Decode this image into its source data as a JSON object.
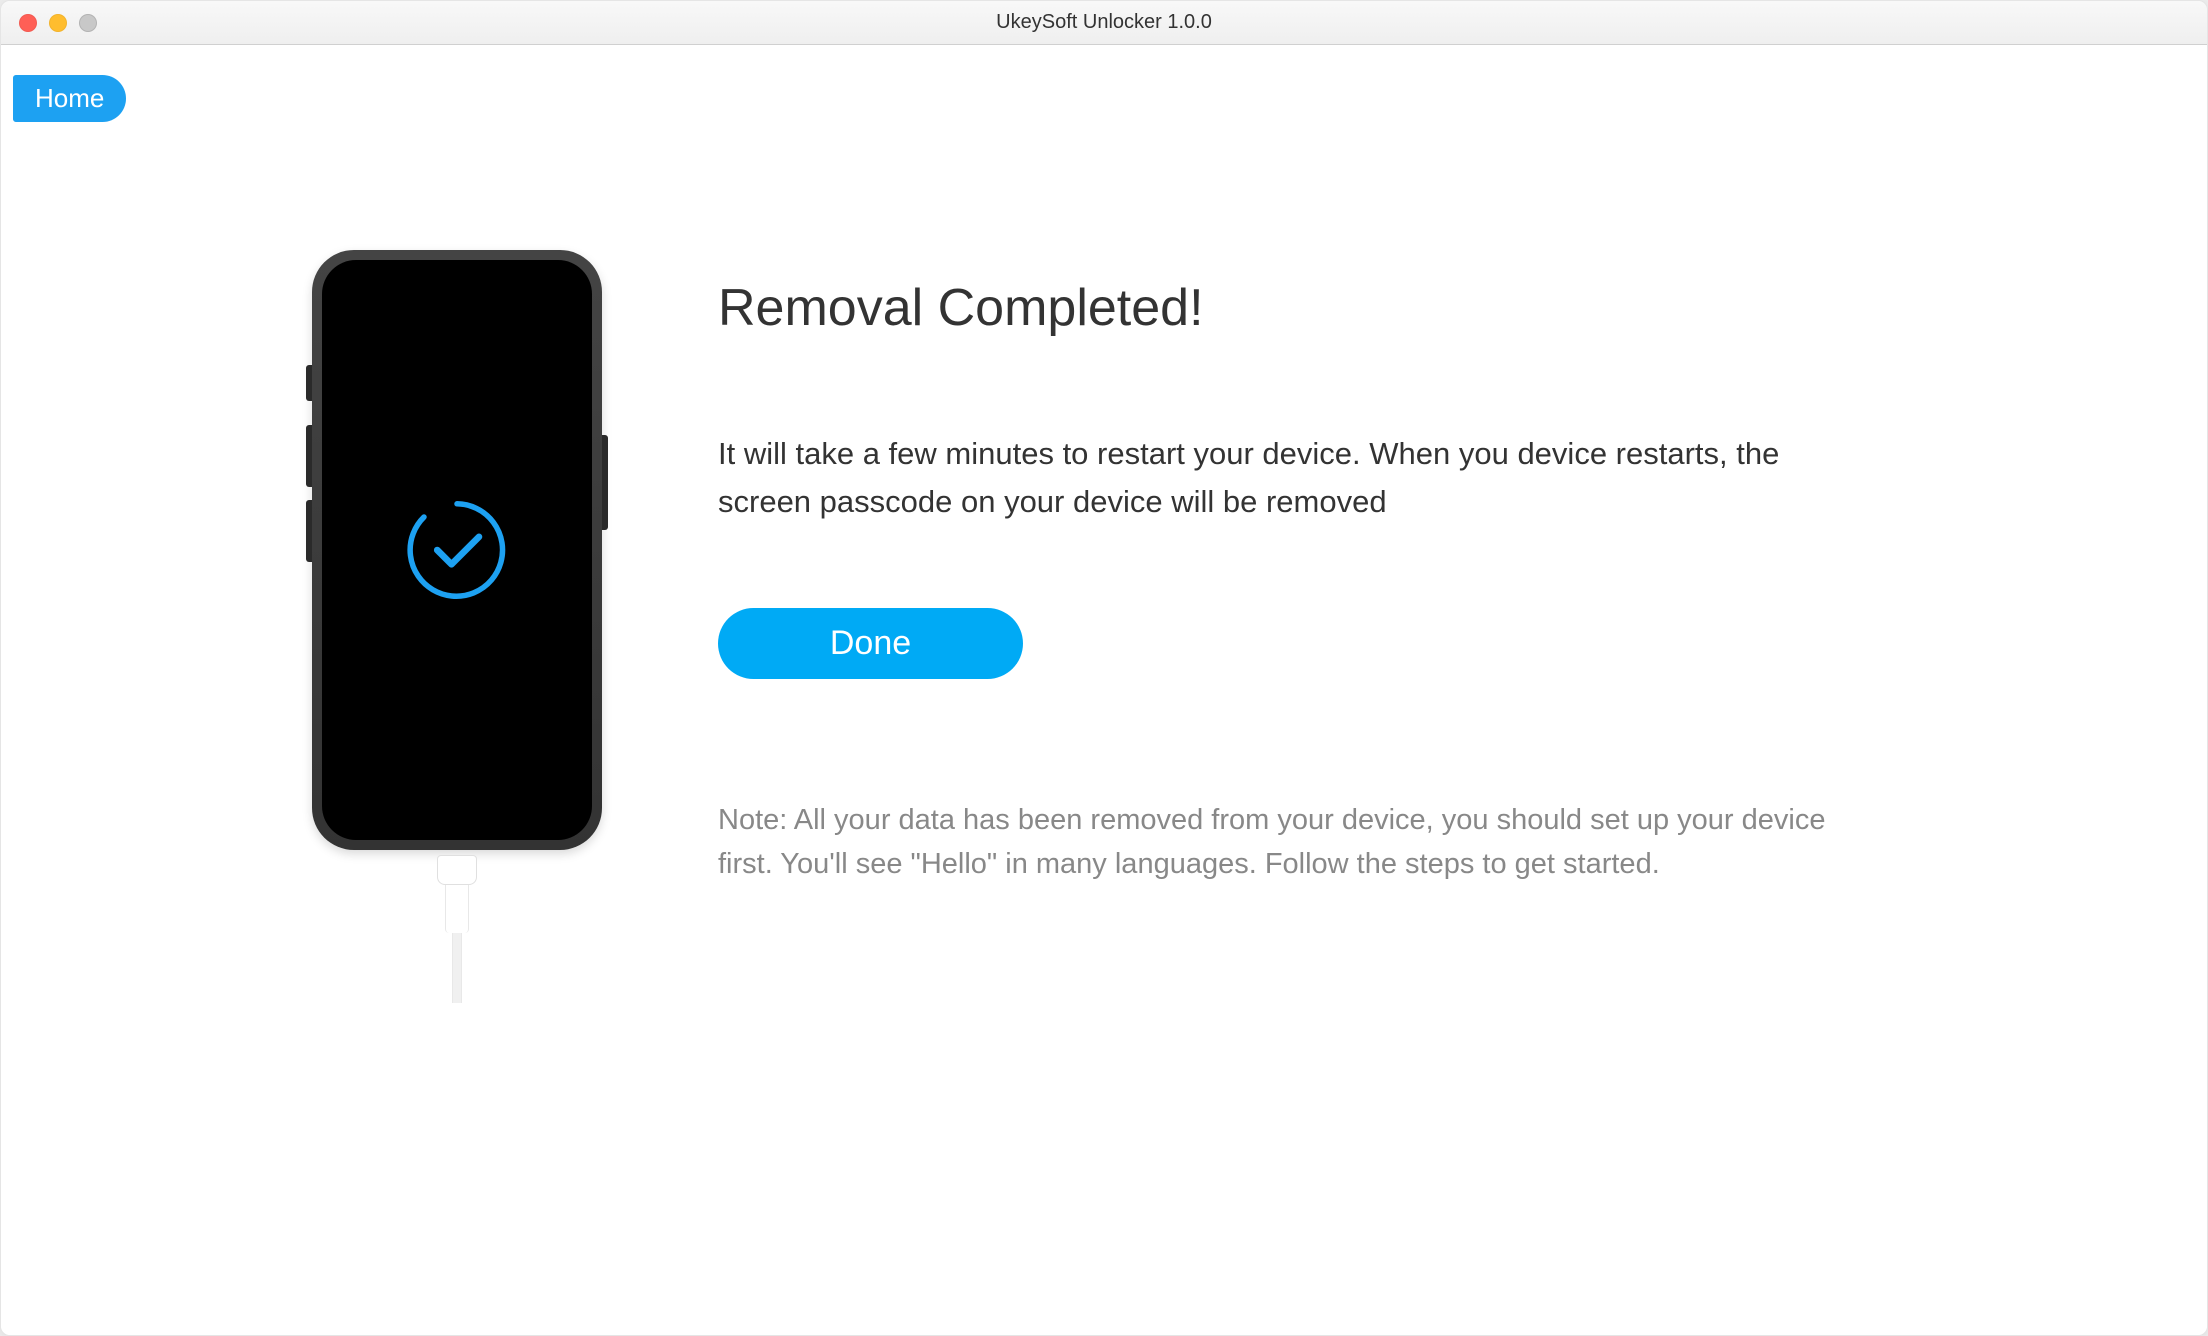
{
  "window": {
    "title": "UkeySoft Unlocker 1.0.0"
  },
  "nav": {
    "home_label": "Home"
  },
  "main": {
    "heading": "Removal Completed!",
    "description": "It will take a few minutes to restart your device. When you device restarts, the screen passcode on your device will be removed",
    "done_label": "Done",
    "note": "Note: All your data has been removed from your device, you should set up your device first. You'll see \"Hello\" in many languages. Follow the steps to get started."
  },
  "colors": {
    "accent": "#1da1f2",
    "button": "#00aaf5"
  }
}
